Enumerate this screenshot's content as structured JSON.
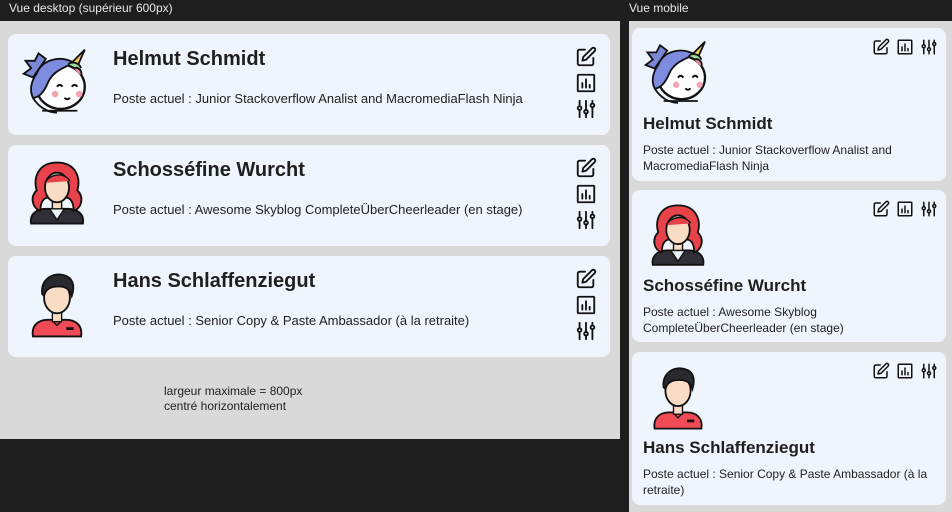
{
  "labels": {
    "desktop": "Vue desktop (supérieur 600px)",
    "mobile": "Vue mobile"
  },
  "people": [
    {
      "name": "Helmut Schmidt",
      "job": "Poste actuel : Junior Stackoverflow Analist and MacromediaFlash Ninja",
      "avatar": "unicorn-avatar"
    },
    {
      "name": "Schosséfine Wurcht",
      "job": "Poste actuel : Awesome Skyblog CompleteÜberCheerleader (en stage)",
      "avatar": "red-haired-woman-avatar"
    },
    {
      "name": "Hans Schlaffenziegut",
      "job": "Poste actuel : Senior Copy & Paste Ambassador (à la retraite)",
      "avatar": "dark-haired-man-avatar"
    }
  ],
  "icons": [
    "edit-icon",
    "chart-icon",
    "settings-sliders-icon"
  ],
  "note": {
    "line1": "largeur maximale = 800px",
    "line2": "centré horizontalement"
  },
  "colors": {
    "card": "#eef5fd",
    "frame": "#d9d9d9",
    "background": "#1e1e1e"
  }
}
